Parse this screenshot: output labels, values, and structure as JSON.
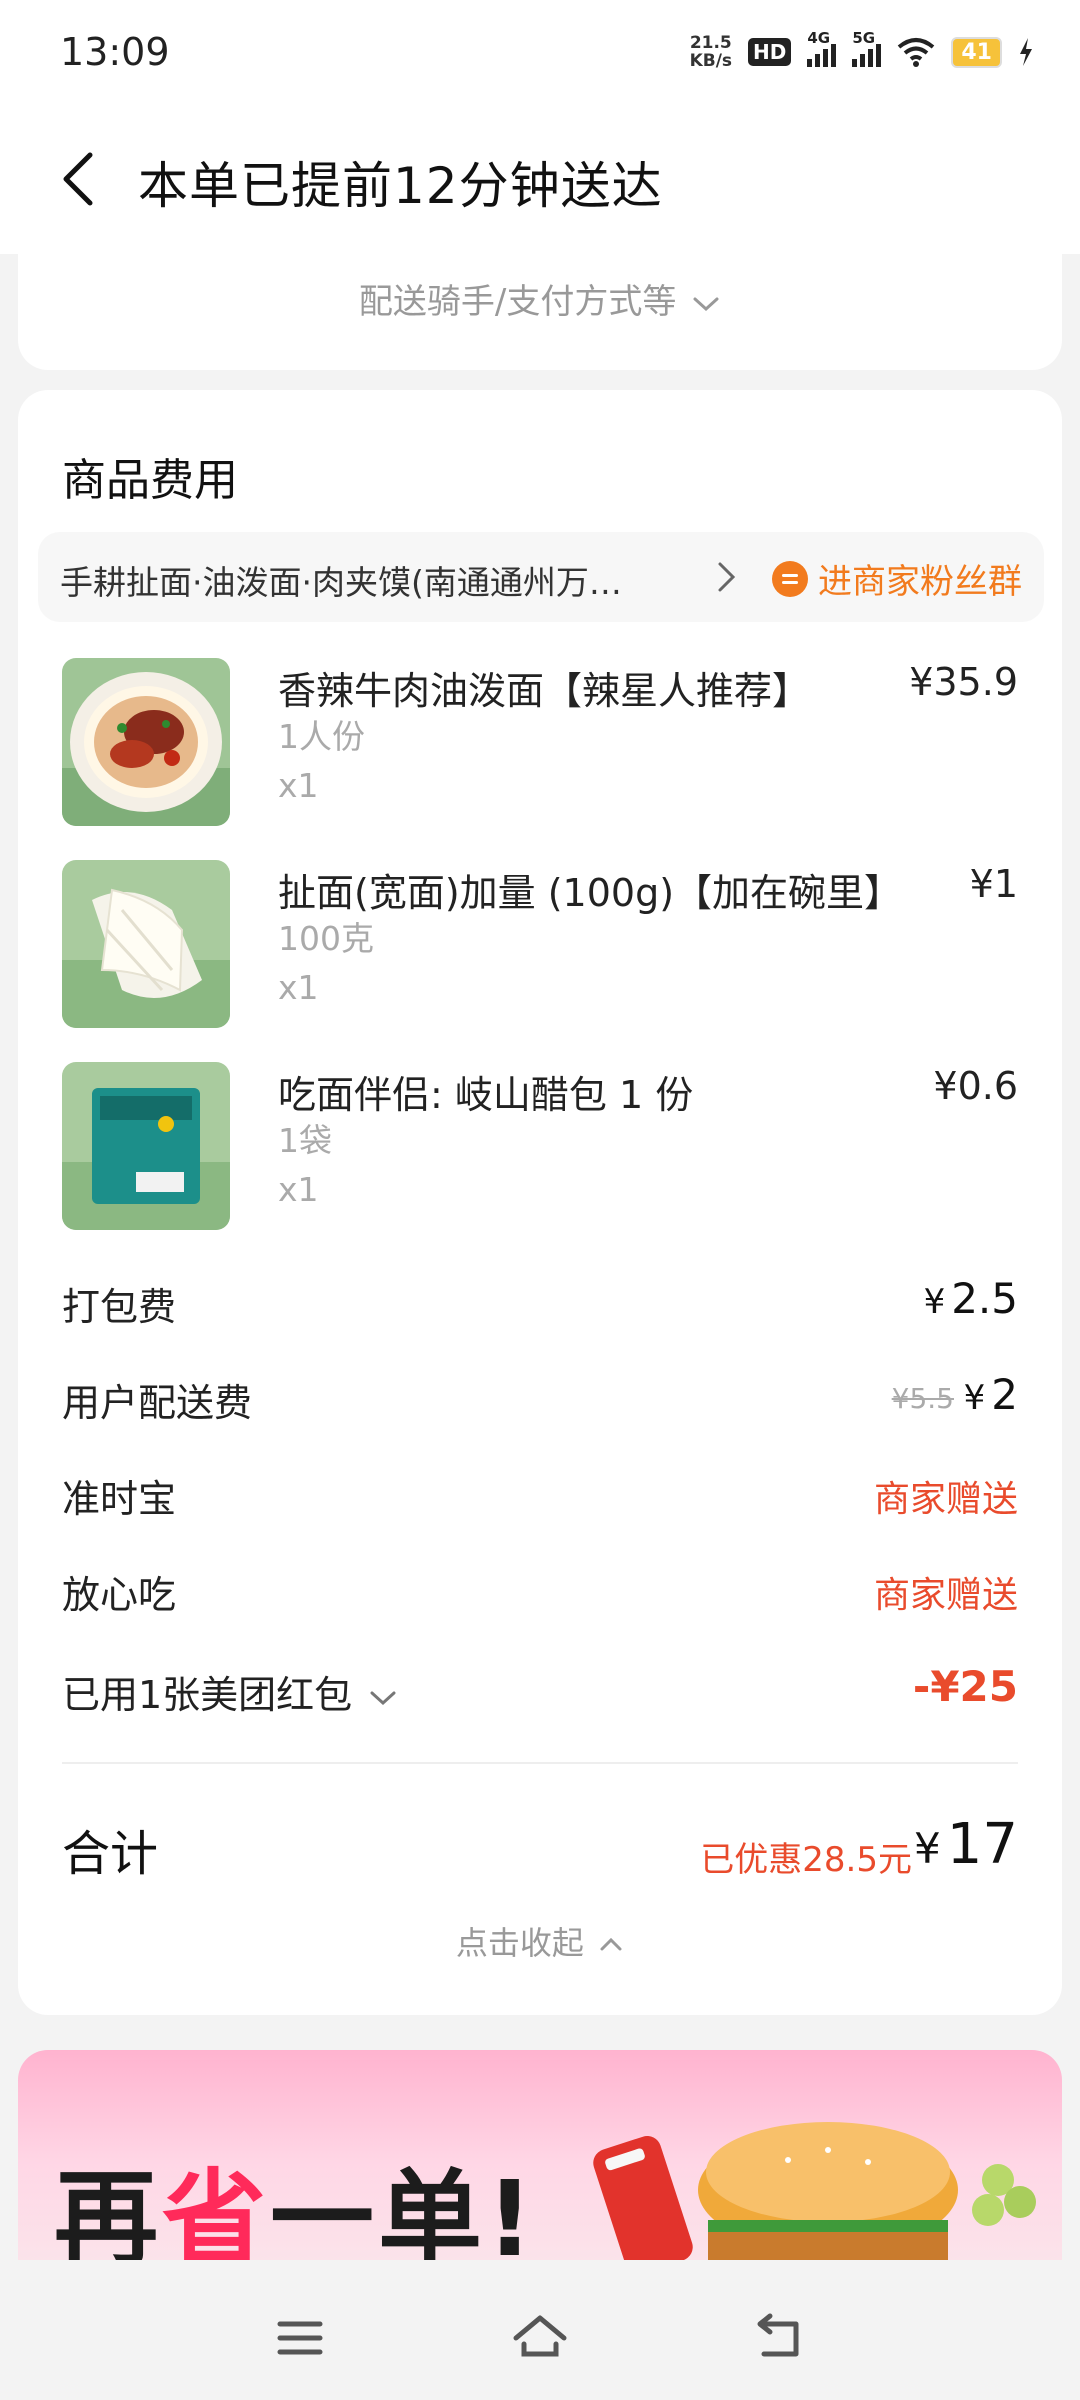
{
  "status_bar": {
    "time": "13:09",
    "net_speed_value": "21.5",
    "net_speed_unit": "KB/s",
    "hd_badge": "HD",
    "sim1_label": "4G",
    "sim2_label": "5G",
    "battery": "41",
    "icons": [
      "hd-icon",
      "signal-4g-icon",
      "signal-5g-icon",
      "wifi-icon",
      "battery-icon",
      "charging-bolt-icon"
    ]
  },
  "header": {
    "title": "本单已提前12分钟送达",
    "back_icon": "back-arrow-icon"
  },
  "delivery_info": {
    "toggle_label": "配送骑手/支付方式等"
  },
  "goods": {
    "section_title": "商品费用",
    "store_name": "手耕扯面·油泼面·肉夹馍(南通通州万…",
    "fan_group_label": "进商家粉丝群",
    "items": [
      {
        "name": "香辣牛肉油泼面【辣星人推荐】",
        "spec": "1人份",
        "qty": "x1",
        "price": "¥35.9"
      },
      {
        "name": "扯面(宽面)加量 (100g)【加在碗里】",
        "spec": "100克",
        "qty": "x1",
        "price": "¥1"
      },
      {
        "name": "吃面伴侣: 岐山醋包 1 份",
        "spec": "1袋",
        "qty": "x1",
        "price": "¥0.6"
      }
    ]
  },
  "fees": {
    "packing_label": "打包费",
    "packing_value": "2.5",
    "delivery_label": "用户配送费",
    "delivery_original": "¥5.5",
    "delivery_value": "2",
    "ontime_label": "准时宝",
    "ontime_value": "商家赠送",
    "safe_label": "放心吃",
    "safe_value": "商家赠送",
    "coupon_label": "已用1张美团红包",
    "coupon_value": "-¥25",
    "currency": "¥"
  },
  "total": {
    "label": "合计",
    "saved": "已优惠28.5元",
    "value": "17",
    "collapse_label": "点击收起"
  },
  "banner": {
    "text_a": "再",
    "text_b": "省",
    "text_c": "一单!"
  },
  "colors": {
    "accent_orange": "#f27b1e",
    "discount_red": "#e94b2c",
    "banner_pink": "#ffb3cf"
  }
}
